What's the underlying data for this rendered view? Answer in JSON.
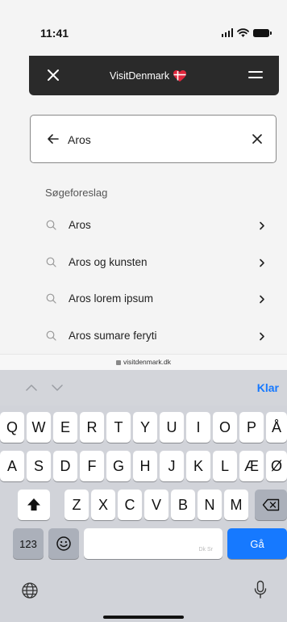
{
  "status_bar": {
    "time": "11:41"
  },
  "header": {
    "brand": "VisitDenmark"
  },
  "search": {
    "value": "Aros",
    "placeholder": ""
  },
  "suggestions": {
    "heading": "Søgeforeslag",
    "items": [
      {
        "label": "Aros"
      },
      {
        "label": "Aros og kunsten"
      },
      {
        "label": "Aros lorem ipsum"
      },
      {
        "label": "Aros sumare feryti"
      }
    ]
  },
  "browser": {
    "url": "visitdenmark.dk"
  },
  "keyboard": {
    "done_label": "Klar",
    "row1": [
      "Q",
      "W",
      "E",
      "R",
      "T",
      "Y",
      "U",
      "I",
      "O",
      "P",
      "Å"
    ],
    "row2": [
      "A",
      "S",
      "D",
      "F",
      "G",
      "H",
      "J",
      "K",
      "L",
      "Æ",
      "Ø"
    ],
    "row3": [
      "Z",
      "X",
      "C",
      "V",
      "B",
      "N",
      "M"
    ],
    "numbers_label": "123",
    "go_label": "Gå",
    "space_hint": "Dk Sr"
  },
  "colors": {
    "accent": "#1679ff",
    "header_bg": "#2a2a2a",
    "brand_heart": "#e0263c"
  }
}
